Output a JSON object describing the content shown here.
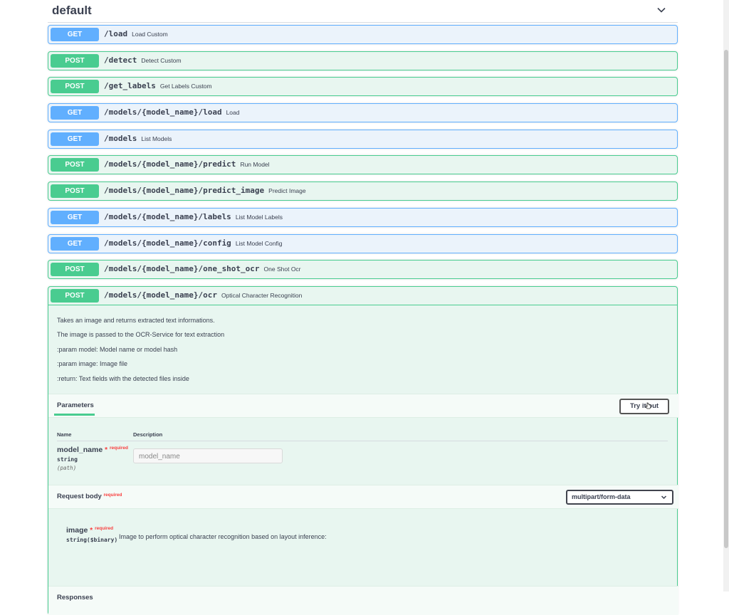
{
  "section": {
    "title": "default"
  },
  "operations": [
    {
      "method": "GET",
      "path": "/load",
      "summary": "Load Custom"
    },
    {
      "method": "POST",
      "path": "/detect",
      "summary": "Detect Custom"
    },
    {
      "method": "POST",
      "path": "/get_labels",
      "summary": "Get Labels Custom"
    },
    {
      "method": "GET",
      "path": "/models/{model_name}/load",
      "summary": "Load"
    },
    {
      "method": "GET",
      "path": "/models",
      "summary": "List Models"
    },
    {
      "method": "POST",
      "path": "/models/{model_name}/predict",
      "summary": "Run Model"
    },
    {
      "method": "POST",
      "path": "/models/{model_name}/predict_image",
      "summary": "Predict Image"
    },
    {
      "method": "GET",
      "path": "/models/{model_name}/labels",
      "summary": "List Model Labels"
    },
    {
      "method": "GET",
      "path": "/models/{model_name}/config",
      "summary": "List Model Config"
    },
    {
      "method": "POST",
      "path": "/models/{model_name}/one_shot_ocr",
      "summary": "One Shot Ocr"
    }
  ],
  "expanded": {
    "method": "POST",
    "path": "/models/{model_name}/ocr",
    "summary": "Optical Character Recognition",
    "description": [
      "Takes an image and returns extracted text informations.",
      "The image is passed to the OCR-Service for text extraction",
      ":param model: Model name or model hash",
      ":param image: Image file",
      ":return: Text fields with the detected files inside"
    ],
    "parameters_label": "Parameters",
    "try_label": "Try it out",
    "col_name": "Name",
    "col_description": "Description",
    "param": {
      "name": "model_name",
      "star": "*",
      "required": "required",
      "type": "string",
      "in": "(path)",
      "placeholder": "model_name"
    },
    "request_body": {
      "title": "Request body",
      "required": "required",
      "content_type": "multipart/form-data",
      "field_name": "image",
      "field_star": "*",
      "field_required": "required",
      "field_type": "string($binary)",
      "field_description": "Image to perform optical character recognition based on layout inference:"
    },
    "responses_label": "Responses"
  },
  "colors": {
    "get": "#61affe",
    "post": "#49cc90",
    "required": "#f93e3e"
  }
}
